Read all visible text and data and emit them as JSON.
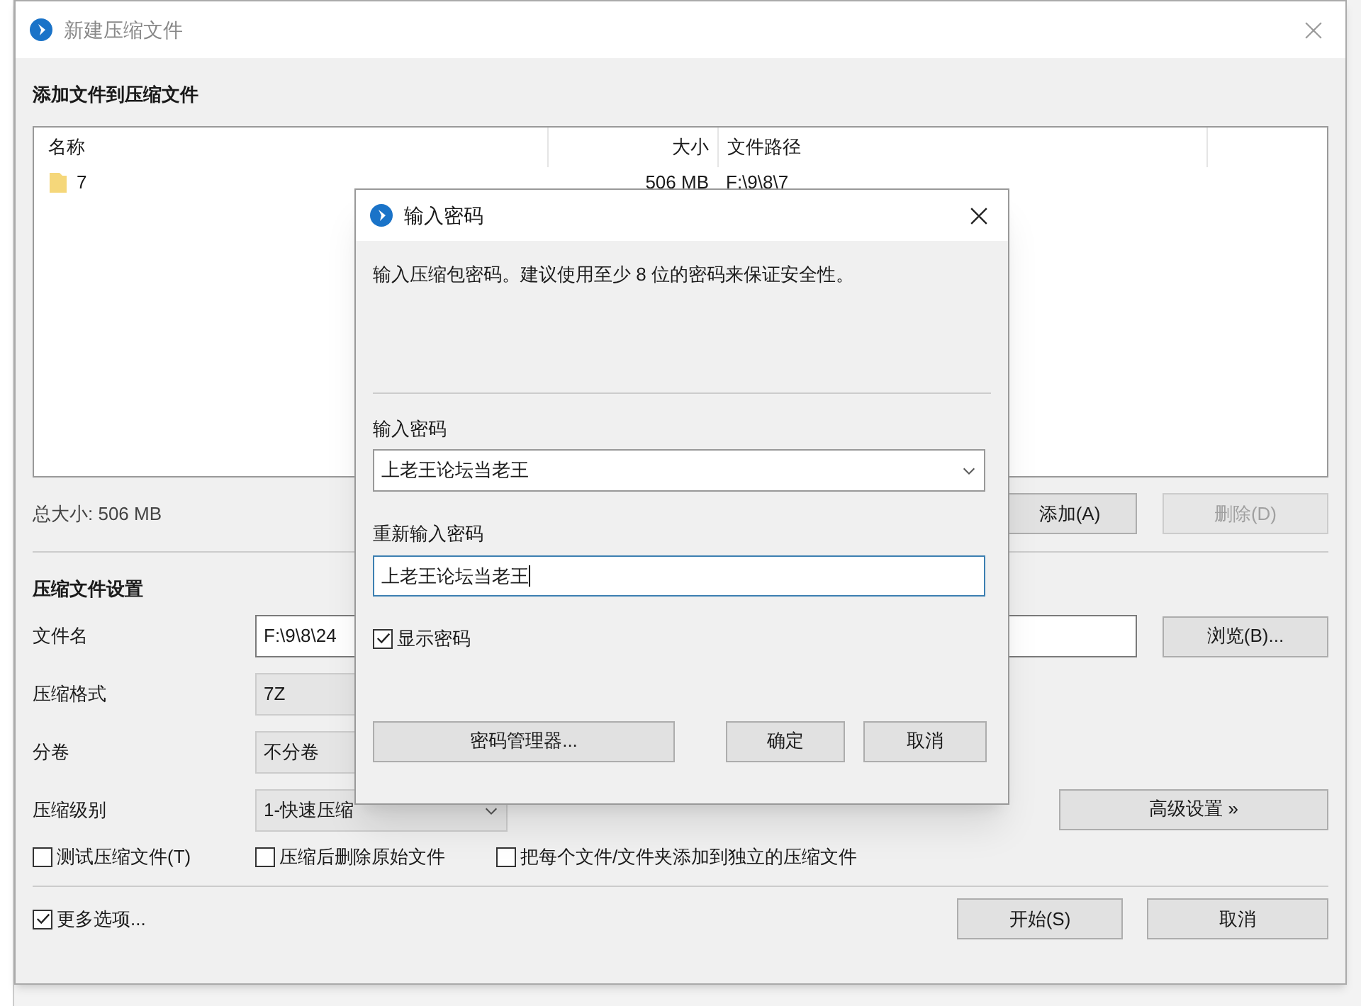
{
  "main_window": {
    "title": "新建压缩文件",
    "files_heading": "添加文件到压缩文件",
    "file_list": {
      "columns": [
        "名称",
        "大小",
        "文件路径"
      ],
      "rows": [
        {
          "name": "7",
          "size": "506 MB",
          "path": "F:\\9\\8\\7"
        }
      ]
    },
    "total_size": "总大小: 506 MB",
    "list_buttons": [
      {
        "label": "添加(A)",
        "disabled": false
      },
      {
        "label": "删除(D)",
        "disabled": true
      }
    ],
    "settings_heading": "压缩文件设置",
    "settings": [
      {
        "label": "文件名",
        "kind": "input",
        "value": "F:\\9\\8\\24"
      },
      {
        "label": "压缩格式",
        "kind": "dropdown",
        "value": "7Z"
      },
      {
        "label": "分卷",
        "kind": "dropdown",
        "value": "不分卷"
      },
      {
        "label": "压缩级别",
        "kind": "dropdown",
        "value": "1-快速压缩"
      }
    ],
    "browse_button": "浏览(B)...",
    "advanced_button": "高级设置 »",
    "options": [
      {
        "label": "测试压缩文件(T)",
        "checked": false
      },
      {
        "label": "压缩后删除原始文件",
        "checked": false
      },
      {
        "label": "把每个文件/文件夹添加到独立的压缩文件",
        "checked": false
      }
    ],
    "more_options": {
      "label": "更多选项...",
      "checked": true
    },
    "buttons": [
      "开始(S)",
      "取消"
    ]
  },
  "password_dialog": {
    "title": "输入密码",
    "message": "输入压缩包密码。建议使用至少 8 位的密码来保证安全性。",
    "password_label": "输入密码",
    "password_value": "上老王论坛当老王",
    "confirm_label": "重新输入密码",
    "confirm_value": "上老王论坛当老王",
    "show_password": {
      "label": "显示密码",
      "checked": true
    },
    "manager_button": "密码管理器...",
    "buttons": [
      "确定",
      "取消"
    ]
  }
}
